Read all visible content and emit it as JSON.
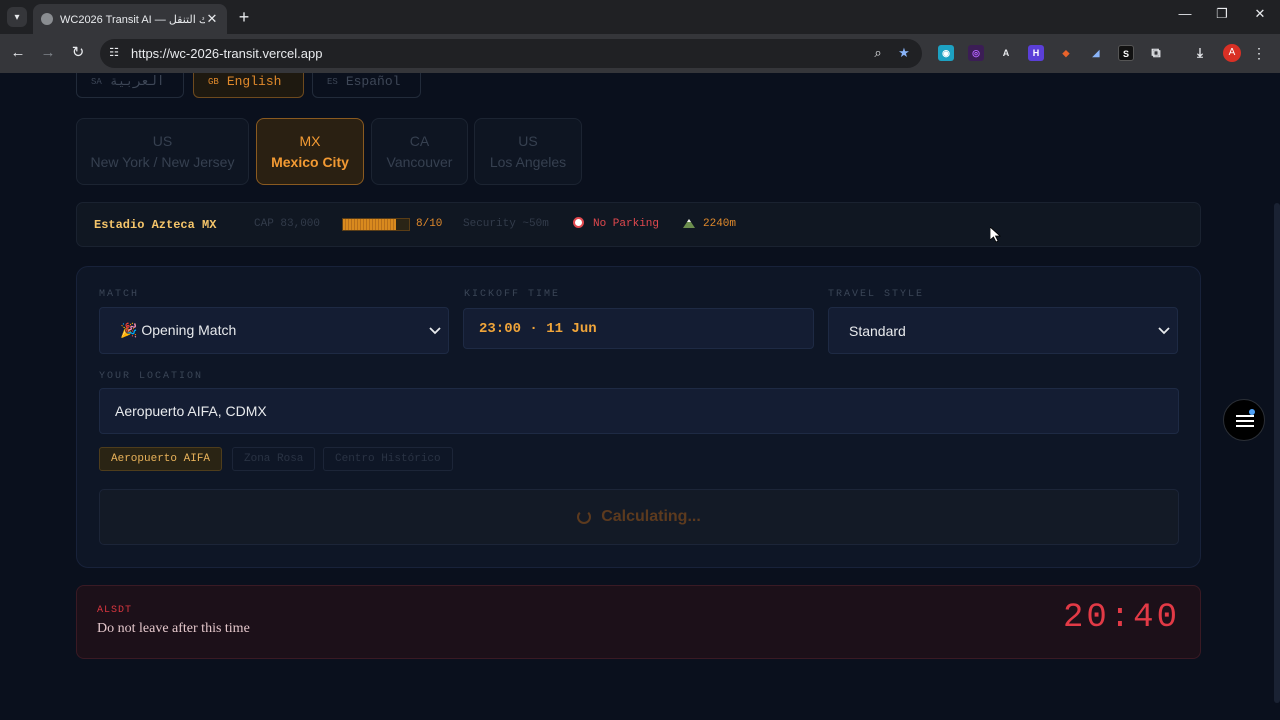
{
  "browser": {
    "tab_title": "WC2026 Transit AI — راك التنقل",
    "url": "https://wc-2026-transit.vercel.app",
    "profile_initial": "A",
    "extensions": [
      "ext-blue",
      "ext-purple",
      "ext-dark",
      "ext-violet",
      "ext-fox",
      "ext-bird",
      "ext-s",
      "puzzle"
    ]
  },
  "languages": [
    {
      "code": "SA",
      "label": "العربية",
      "active": false
    },
    {
      "code": "GB",
      "label": "English",
      "active": true
    },
    {
      "code": "ES",
      "label": "Español",
      "active": false
    }
  ],
  "cities": [
    {
      "country": "US",
      "name": "New York / New Jersey",
      "active": false
    },
    {
      "country": "MX",
      "name": "Mexico City",
      "active": true
    },
    {
      "country": "CA",
      "name": "Vancouver",
      "active": false
    },
    {
      "country": "US",
      "name": "Los Angeles",
      "active": false
    }
  ],
  "stadium": {
    "name": "Estadio Azteca MX",
    "capacity": "CAP 83,000",
    "score_fraction": 0.8,
    "score": "8/10",
    "security": "Security ~50m",
    "parking": "No Parking",
    "altitude": "2240m"
  },
  "form": {
    "match_label": "MATCH",
    "match_value": "🎉 Opening Match",
    "kickoff_label": "KICKOFF TIME",
    "kickoff_value": "23:00 · 11 Jun",
    "style_label": "TRAVEL STYLE",
    "style_value": "Standard",
    "location_label": "YOUR LOCATION",
    "location_value": "Aeropuerto AIFA, CDMX",
    "chips": [
      {
        "label": "Aeropuerto AIFA",
        "active": true
      },
      {
        "label": "Zona Rosa",
        "active": false
      },
      {
        "label": "Centro Histórico",
        "active": false
      }
    ],
    "calculate_label": "Calculating..."
  },
  "alert": {
    "code": "ALSDT",
    "message": "Do not leave after this time",
    "time": "20:40"
  },
  "colors": {
    "accent": "#f39a33",
    "alert": "#e23a46",
    "page_bg": "#0a101d"
  }
}
